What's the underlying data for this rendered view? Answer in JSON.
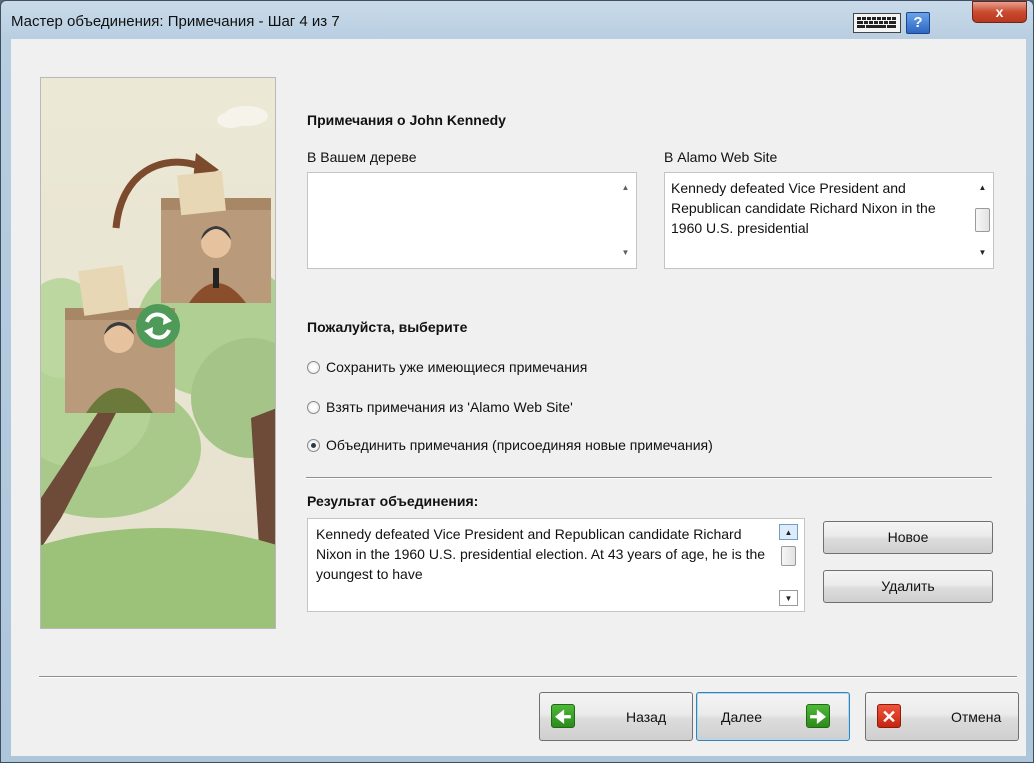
{
  "window": {
    "title": "Мастер объединения: Примечания - Шаг 4 из 7",
    "help_label": "?",
    "close_label": "x"
  },
  "notes": {
    "heading": "Примечания о John Kennedy",
    "left_label": "В Вашем дереве",
    "left_text": "",
    "right_label": "В Alamo Web Site",
    "right_text": "Kennedy defeated Vice President and Republican candidate Richard Nixon in the 1960 U.S. presidential"
  },
  "choice": {
    "heading": "Пожалуйста, выберите",
    "options": [
      {
        "label": "Сохранить уже имеющиеся примечания",
        "checked": false
      },
      {
        "label": "Взять примечания из 'Alamo Web Site'",
        "checked": false
      },
      {
        "label": "Объединить примечания (присоединяя новые примечания)",
        "checked": true
      }
    ]
  },
  "result": {
    "heading": "Результат объединения:",
    "text": "Kennedy defeated Vice President and Republican candidate Richard Nixon in the 1960 U.S. presidential election. At 43 years of age, he is the youngest to have",
    "new_label": "Новое",
    "delete_label": "Удалить"
  },
  "footer": {
    "back_label": "Назад",
    "next_label": "Далее",
    "cancel_label": "Отмена"
  },
  "colors": {
    "accent_green": "#2c8a1c",
    "cancel_red": "#c5250f",
    "focus_blue": "#3c7fb1"
  }
}
